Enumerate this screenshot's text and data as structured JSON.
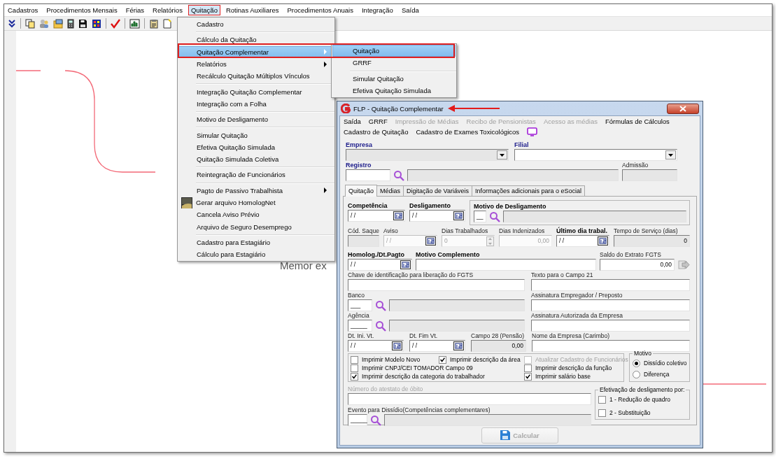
{
  "menubar": [
    {
      "label": "Cadastros",
      "selected": false
    },
    {
      "label": "Procedimentos Mensais",
      "selected": false
    },
    {
      "label": "Férias",
      "selected": false
    },
    {
      "label": "Relatórios",
      "selected": false
    },
    {
      "label": "Quitação",
      "selected": true
    },
    {
      "label": "Rotinas Auxiliares",
      "selected": false
    },
    {
      "label": "Procedimentos Anuais",
      "selected": false
    },
    {
      "label": "Integração",
      "selected": false
    },
    {
      "label": "Saída",
      "selected": false
    }
  ],
  "background_text": "Memor ex",
  "menu": {
    "items": [
      {
        "kind": "item",
        "label": "Cadastro",
        "selected": false,
        "submenu": false
      },
      {
        "kind": "separator"
      },
      {
        "kind": "item",
        "label": "Cálculo da Quitação",
        "selected": false,
        "submenu": false
      },
      {
        "kind": "item",
        "label": "Quitação Complementar",
        "selected": true,
        "submenu": true
      },
      {
        "kind": "item",
        "label": "Relatórios",
        "selected": false,
        "submenu": true
      },
      {
        "kind": "item",
        "label": "Recálculo Quitação Múltiplos Vínculos",
        "selected": false,
        "submenu": false
      },
      {
        "kind": "separator"
      },
      {
        "kind": "item",
        "label": "Integração Quitação Complementar",
        "selected": false,
        "submenu": false
      },
      {
        "kind": "item",
        "label": "Integração com a Folha",
        "selected": false,
        "submenu": false
      },
      {
        "kind": "separator"
      },
      {
        "kind": "item",
        "label": "Motivo de Desligamento",
        "selected": false,
        "submenu": false
      },
      {
        "kind": "separator"
      },
      {
        "kind": "item",
        "label": "Simular Quitação",
        "selected": false,
        "submenu": false
      },
      {
        "kind": "item",
        "label": "Efetiva Quitação Simulada",
        "selected": false,
        "submenu": false
      },
      {
        "kind": "item",
        "label": "Quitação Simulada Coletiva",
        "selected": false,
        "submenu": false
      },
      {
        "kind": "separator"
      },
      {
        "kind": "item",
        "label": "Reintegração de Funcionários",
        "selected": false,
        "submenu": false
      },
      {
        "kind": "separator"
      },
      {
        "kind": "item",
        "label": "Pagto de Passivo Trabalhista",
        "selected": false,
        "submenu": true
      },
      {
        "kind": "icon-item",
        "label": "Gerar arquivo HomologNet",
        "selected": false,
        "submenu": false
      },
      {
        "kind": "item",
        "label": "Cancela Aviso Prévio",
        "selected": false,
        "submenu": false
      },
      {
        "kind": "item",
        "label": "Arquivo de Seguro Desemprego",
        "selected": false,
        "submenu": false
      },
      {
        "kind": "separator"
      },
      {
        "kind": "item",
        "label": "Cadastro para Estagiário",
        "selected": false,
        "submenu": false
      },
      {
        "kind": "item",
        "label": "Cálculo para Estagiário",
        "selected": false,
        "submenu": false
      }
    ]
  },
  "submenu": {
    "items": [
      {
        "kind": "item",
        "label": "Quitação",
        "selected": true,
        "submenu": false
      },
      {
        "kind": "item",
        "label": "GRRF",
        "selected": false,
        "submenu": false
      },
      {
        "kind": "separator"
      },
      {
        "kind": "item",
        "label": "Simular Quitação",
        "selected": false,
        "submenu": false
      },
      {
        "kind": "item",
        "label": "Efetiva Quitação Simulada",
        "selected": false,
        "submenu": false
      }
    ]
  },
  "dialog": {
    "title": "FLP - Quitação Complementar",
    "menu_rows": [
      [
        {
          "label": "Saída",
          "disabled": false
        },
        {
          "label": "GRRF",
          "disabled": false
        },
        {
          "label": "Impressão de Médias",
          "disabled": true
        },
        {
          "label": "Recibo de Pensionistas",
          "disabled": true
        },
        {
          "label": "Acesso as médias",
          "disabled": true
        },
        {
          "label": "Fórmulas de Cálculos",
          "disabled": false
        }
      ],
      [
        {
          "label": "Cadastro de Quitação",
          "disabled": false
        },
        {
          "label": "Cadastro de Exames Toxicológicos",
          "disabled": false
        }
      ]
    ],
    "header_rows": [
      [
        {
          "kind": "combo",
          "label": "Empresa",
          "required": true,
          "bold": true,
          "dimmed": false,
          "readonly": true,
          "disabled": false
        },
        {
          "kind": "combo",
          "label": "Filial",
          "required": true,
          "bold": true,
          "dimmed": false,
          "readonly": false,
          "disabled": false
        }
      ],
      [
        {
          "kind": "lookup",
          "label": "Registro",
          "required": true,
          "bold": true,
          "dimmed": false,
          "readonly": false,
          "disabled": false
        },
        {
          "kind": "text",
          "label": "Admissão",
          "required": false,
          "bold": false,
          "dimmed": false,
          "readonly": true,
          "disabled": false
        }
      ]
    ],
    "tabs": [
      {
        "label": "Quitação",
        "selected": true
      },
      {
        "label": "Médias",
        "selected": false
      },
      {
        "label": "Digitação de Variáveis",
        "selected": false
      },
      {
        "label": "Informações adicionais para o eSocial",
        "selected": false
      }
    ],
    "tab_rows": [
      [
        {
          "kind": "date",
          "label": "Competência",
          "required": false,
          "bold": true,
          "dimmed": false,
          "readonly": false,
          "disabled": false,
          "value": "/ /"
        },
        {
          "kind": "date",
          "label": "Desligamento",
          "required": false,
          "bold": true,
          "dimmed": false,
          "readonly": false,
          "disabled": false,
          "value": "/ /"
        },
        {
          "kind": "lookup-group",
          "label": "Motivo de Desligamento",
          "required": false,
          "bold": true,
          "dimmed": false,
          "readonly": false,
          "disabled": false,
          "value": "__"
        }
      ],
      [
        {
          "kind": "text",
          "label": "Cód. Saque",
          "required": false,
          "bold": false,
          "dimmed": false,
          "readonly": true,
          "disabled": false
        },
        {
          "kind": "date",
          "label": "Aviso",
          "required": false,
          "bold": false,
          "dimmed": false,
          "readonly": false,
          "disabled": true,
          "value": "/ /"
        },
        {
          "kind": "spin",
          "label": "Dias Trabalhados",
          "required": false,
          "bold": false,
          "dimmed": false,
          "readonly": false,
          "disabled": true,
          "value": "0"
        },
        {
          "kind": "number",
          "label": "Dias Indenizados",
          "required": false,
          "bold": false,
          "dimmed": false,
          "readonly": false,
          "disabled": true,
          "value": "0,00"
        },
        {
          "kind": "date",
          "label": "Último dia trabal.",
          "required": false,
          "bold": true,
          "dimmed": false,
          "readonly": false,
          "disabled": false,
          "value": "/ /"
        },
        {
          "kind": "number",
          "label": "Tempo de Serviço (dias)",
          "required": false,
          "bold": false,
          "dimmed": false,
          "readonly": true,
          "disabled": false,
          "value": "0"
        }
      ],
      [
        {
          "kind": "date",
          "label": "Homolog./Dt.Pagto",
          "required": false,
          "bold": true,
          "dimmed": false,
          "readonly": false,
          "disabled": false,
          "value": "/ /"
        },
        {
          "kind": "text",
          "label": "Motivo Complemento",
          "required": false,
          "bold": true,
          "dimmed": false,
          "readonly": false,
          "disabled": false
        },
        {
          "kind": "number-action",
          "label": "Saldo do Extrato FGTS",
          "required": false,
          "bold": false,
          "dimmed": false,
          "readonly": false,
          "disabled": false,
          "value": "0,00"
        }
      ],
      [
        {
          "kind": "text",
          "label": "Chave de identificação para liberação do FGTS",
          "required": false,
          "bold": false,
          "dimmed": false,
          "readonly": false,
          "disabled": false
        },
        {
          "kind": "text",
          "label": "Texto para o Campo 21",
          "required": false,
          "bold": false,
          "dimmed": false,
          "readonly": false,
          "disabled": false
        }
      ],
      [
        {
          "kind": "lookup",
          "label": "Banco",
          "required": false,
          "bold": false,
          "dimmed": false,
          "readonly": false,
          "disabled": false,
          "value": "___"
        },
        {
          "kind": "text",
          "label": "Assinatura Empregador / Preposto",
          "required": false,
          "bold": false,
          "dimmed": false,
          "readonly": false,
          "disabled": false
        }
      ],
      [
        {
          "kind": "lookup",
          "label": "Agência",
          "required": false,
          "bold": false,
          "dimmed": false,
          "readonly": false,
          "disabled": false,
          "value": "_____"
        },
        {
          "kind": "text",
          "label": "Assinatura Autorizada da Empresa",
          "required": false,
          "bold": false,
          "dimmed": false,
          "readonly": false,
          "disabled": false
        }
      ],
      [
        {
          "kind": "date",
          "label": "Dt. Ini. Vt.",
          "required": false,
          "bold": false,
          "dimmed": false,
          "readonly": false,
          "disabled": false,
          "value": "/ /"
        },
        {
          "kind": "date",
          "label": "Dt. Fim Vt.",
          "required": false,
          "bold": false,
          "dimmed": false,
          "readonly": false,
          "disabled": false,
          "value": "/ /"
        },
        {
          "kind": "number",
          "label": "Campo 28 (Pensão)",
          "required": false,
          "bold": false,
          "dimmed": false,
          "readonly": true,
          "disabled": false,
          "value": "0,00"
        },
        {
          "kind": "text",
          "label": "Nome da Empresa (Carimbo)",
          "required": false,
          "bold": false,
          "dimmed": false,
          "readonly": false,
          "disabled": false
        }
      ]
    ],
    "options": [
      {
        "label": "Imprimir Modelo Novo",
        "checked": false,
        "disabled": false
      },
      {
        "label": "Imprimir descrição da área",
        "checked": true,
        "disabled": false
      },
      {
        "label": "Atualizar Cadastro de Funcionários",
        "checked": false,
        "disabled": true
      },
      {
        "label": "Imprimir CNPJ/CEI TOMADOR Campo 09",
        "checked": false,
        "disabled": false
      },
      {
        "label": "Imprimir descrição da função",
        "checked": false,
        "disabled": false
      },
      {
        "label": "Imprimir descrição da categoria do trabalhador",
        "checked": true,
        "disabled": false
      },
      {
        "label": "Imprimir salário base",
        "checked": true,
        "disabled": false
      }
    ],
    "motivo": {
      "title": "Motivo",
      "options": [
        {
          "label": "Dissídio coletivo",
          "selected": true
        },
        {
          "label": "Diferença",
          "selected": false
        }
      ]
    },
    "bottom_fields": [
      {
        "kind": "text",
        "label": "Número do atestato de óbito",
        "required": false,
        "bold": false,
        "dimmed": true,
        "readonly": false,
        "disabled": false
      },
      {
        "kind": "lookup",
        "label": "Evento para Dissídio(Competências complementares)",
        "required": false,
        "bold": false,
        "dimmed": false,
        "readonly": false,
        "disabled": false,
        "value": "_____"
      }
    ],
    "efetivacao": {
      "title": "Efetivação de desligamento por:",
      "options": [
        {
          "label": "1 - Redução de quadro",
          "checked": false
        },
        {
          "label": "2 - Substituição",
          "checked": false
        }
      ]
    },
    "button": {
      "label": "Calcular",
      "disabled": true
    }
  }
}
